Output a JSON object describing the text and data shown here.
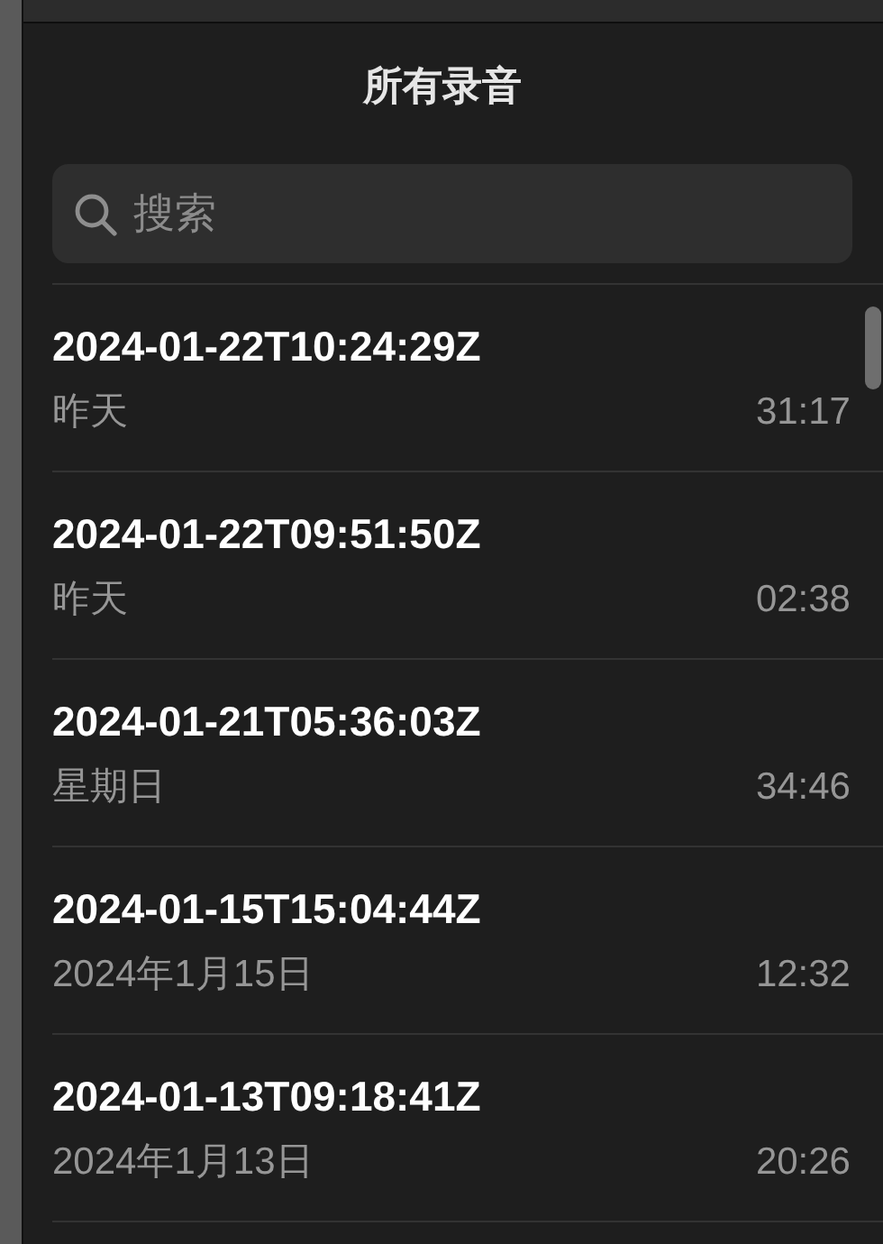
{
  "title": "所有录音",
  "search": {
    "placeholder": "搜索"
  },
  "recordings": [
    {
      "name": "2024-01-22T10:24:29Z",
      "date": "昨天",
      "duration": "31:17"
    },
    {
      "name": "2024-01-22T09:51:50Z",
      "date": "昨天",
      "duration": "02:38"
    },
    {
      "name": "2024-01-21T05:36:03Z",
      "date": "星期日",
      "duration": "34:46"
    },
    {
      "name": "2024-01-15T15:04:44Z",
      "date": "2024年1月15日",
      "duration": "12:32"
    },
    {
      "name": "2024-01-13T09:18:41Z",
      "date": "2024年1月13日",
      "duration": "20:26"
    }
  ]
}
